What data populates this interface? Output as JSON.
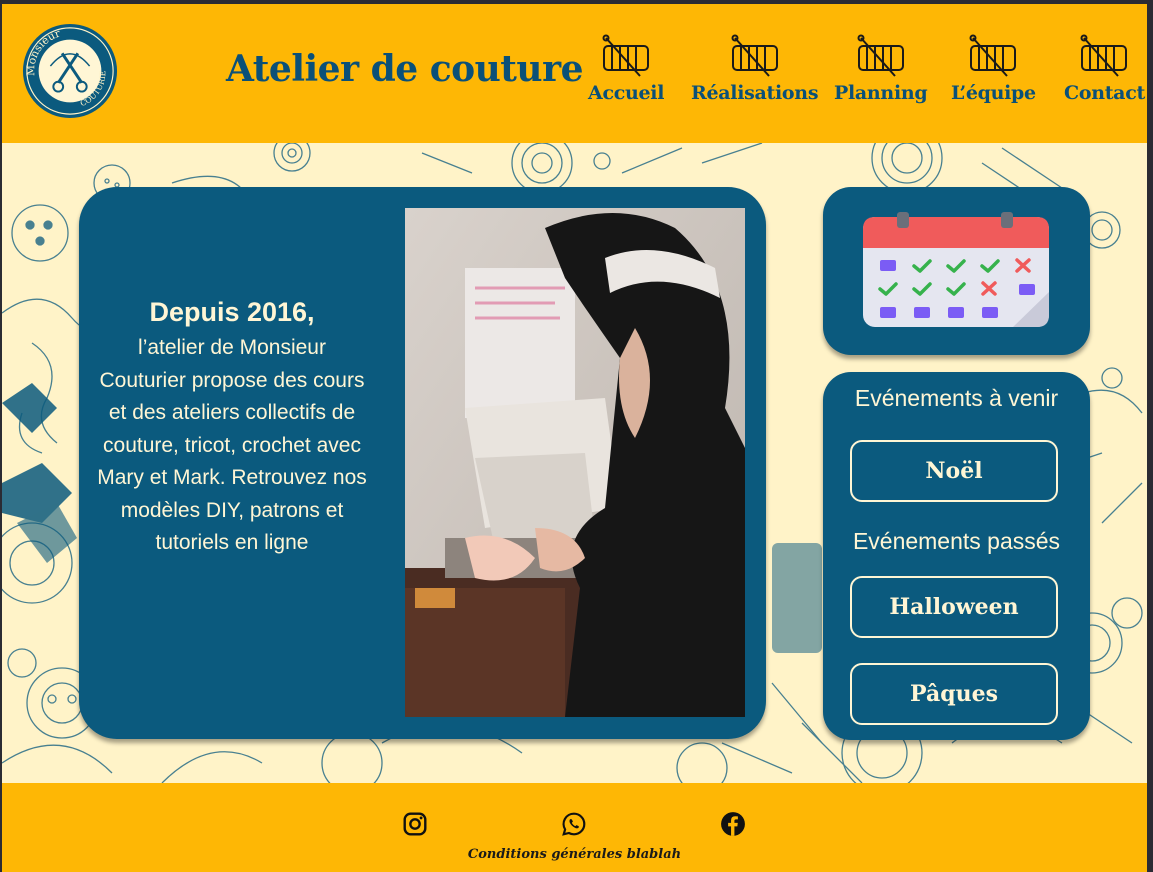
{
  "header": {
    "logo_text_top": "Monsieur",
    "logo_text_bottom": "COUTURIER",
    "site_title": "Atelier de couture",
    "nav": [
      {
        "label": "Accueil",
        "icon": "sewing-icon"
      },
      {
        "label": "Réalisations",
        "icon": "sewing-icon"
      },
      {
        "label": "Planning",
        "icon": "sewing-icon"
      },
      {
        "label": "L’équipe",
        "icon": "sewing-icon"
      },
      {
        "label": "Contact",
        "icon": "sewing-icon"
      }
    ]
  },
  "intro": {
    "heading": "Depuis 2016,",
    "body": "l’atelier de Monsieur Couturier propose des cours et des ateliers collectifs de couture, tricot, crochet avec Mary et Mark. Retrouvez nos modèles DIY, patrons et tutoriels en ligne"
  },
  "events": {
    "upcoming_title": "Evénements à venir",
    "upcoming": [
      "Noël"
    ],
    "past_title": "Evénements passés",
    "past": [
      "Halloween",
      "Pâques"
    ]
  },
  "footer": {
    "socials": [
      "instagram-icon",
      "whatsapp-icon",
      "facebook-icon"
    ],
    "legal": "Conditions générales blablah"
  },
  "colors": {
    "primary": "#0b5a7e",
    "accent": "#feb705",
    "cream": "#fff3c8"
  }
}
